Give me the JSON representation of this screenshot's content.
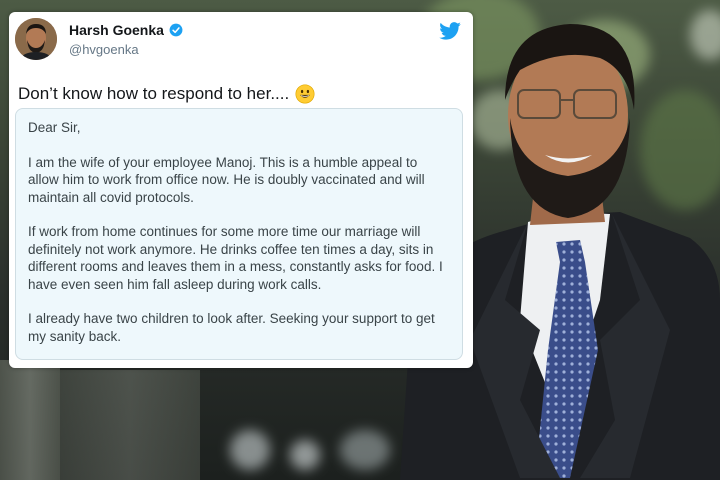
{
  "tweet": {
    "author_name": "Harsh Goenka",
    "author_handle": "@hvgoenka",
    "text": "Don’t know how to respond to her....",
    "letter": {
      "salutation": "Dear Sir,",
      "paragraph1": "I am the wife of your employee Manoj. This is a humble appeal to allow him to work from office now. He is doubly vaccinated and will maintain all covid protocols.",
      "paragraph2": "If work from home continues for some more time our marriage will definitely not work anymore. He drinks coffee ten times a day, sits in different rooms and leaves them in a mess, constantly asks for food. I have even seen him fall asleep during work calls.",
      "paragraph3": "I already have two children to look after. Seeking your support to get my sanity back."
    }
  },
  "icons": {
    "verified": "verified-badge-icon",
    "twitter": "twitter-bird-icon",
    "emoji": "grinning-face-emoji"
  },
  "colors": {
    "twitter_blue": "#1da1f2",
    "letter_background": "#eef8fc"
  }
}
